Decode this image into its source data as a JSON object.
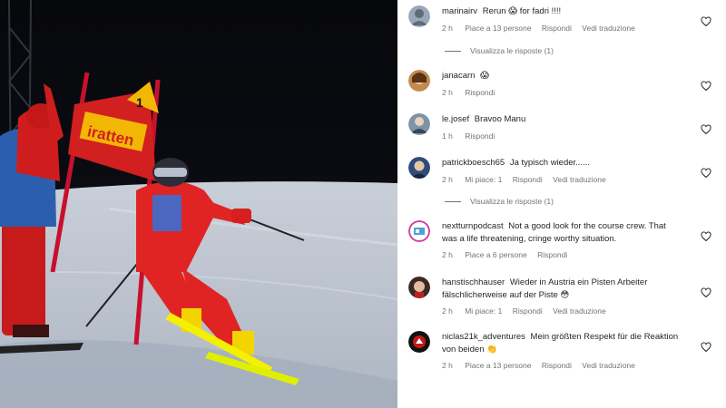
{
  "media": {
    "banner_text": "iratten",
    "gate_text": "1",
    "description_icon": "ski-race-video"
  },
  "comments": [
    {
      "user": "marinairv",
      "text": "Rerun 😱 for fadri !!!!",
      "time": "2 h",
      "likes": "Piace a 13 persone",
      "reply": "Rispondi",
      "translate": "Vedi traduzione",
      "view_replies": "Visualizza le risposte (1)"
    },
    {
      "user": "janacarn",
      "text": "😱",
      "time": "2 h",
      "reply": "Rispondi"
    },
    {
      "user": "le.josef",
      "text": "Bravoo Manu",
      "time": "1 h",
      "reply": "Rispondi"
    },
    {
      "user": "patrickboesch65",
      "text": "Ja typisch wieder......",
      "time": "2 h",
      "likes": "Mi piace: 1",
      "reply": "Rispondi",
      "translate": "Vedi traduzione",
      "view_replies": "Visualizza le risposte (1)"
    },
    {
      "user": "nextturnpodcast",
      "text": "Not a good look for the course crew. That was a life threatening, cringe worthy situation.",
      "time": "2 h",
      "likes": "Piace a 6 persone",
      "reply": "Rispondi"
    },
    {
      "user": "hanstischhauser",
      "text": "Wieder in Austria ein Pisten Arbeiter fälschlicherweise auf der Piste 😳",
      "time": "2 h",
      "likes": "Mi piace: 1",
      "reply": "Rispondi",
      "translate": "Vedi traduzione"
    },
    {
      "user": "niclas21k_adventures",
      "text": "Mein größten Respekt für die Reaktion von beiden 👏",
      "time": "2 h",
      "likes": "Piace a 13 persone",
      "reply": "Rispondi",
      "translate": "Vedi traduzione"
    }
  ],
  "colors": {
    "text": "#262626",
    "meta": "#737373",
    "like": "#262626"
  },
  "icons": {
    "like": "heart-outline-icon"
  }
}
